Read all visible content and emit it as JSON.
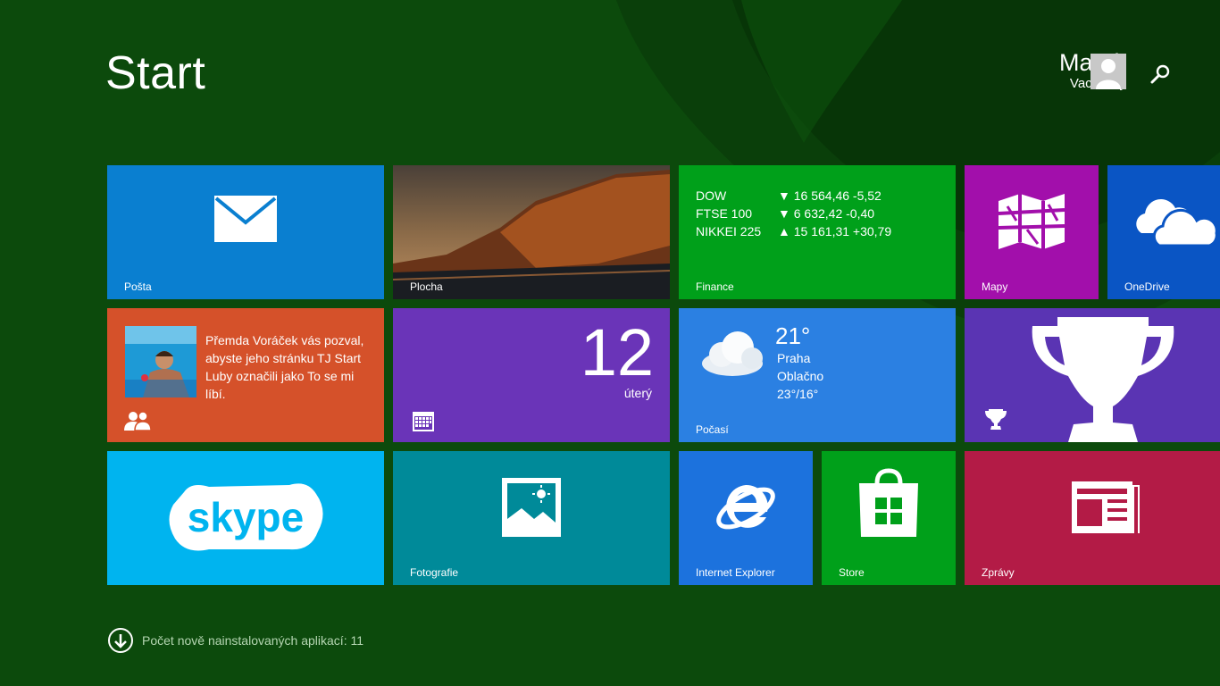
{
  "start": {
    "title": "Start"
  },
  "user": {
    "first_name": "Marek",
    "last_name": "Vacovský"
  },
  "tiles": {
    "mail": {
      "label": "Pošta"
    },
    "desktop": {
      "label": "Plocha"
    },
    "finance": {
      "label": "Finance",
      "rows": [
        {
          "name": "DOW",
          "value": "▼ 16 564,46 -5,52"
        },
        {
          "name": "FTSE 100",
          "value": "▼ 6 632,42 -0,40"
        },
        {
          "name": "NIKKEI 225",
          "value": "▲ 15 161,31 +30,79"
        }
      ]
    },
    "maps": {
      "label": "Mapy"
    },
    "onedrive": {
      "label": "OneDrive"
    },
    "people": {
      "text": "Přemda Voráček vás pozval, abyste jeho stránku TJ Start Luby označili jako To se mi líbí."
    },
    "calendar": {
      "day": "12",
      "weekday": "úterý"
    },
    "weather": {
      "label": "Počasí",
      "temp": "21°",
      "city": "Praha",
      "condition": "Oblačno",
      "range": "23°/16°"
    },
    "skype": {
      "text": "skype"
    },
    "photos": {
      "label": "Fotografie"
    },
    "ie": {
      "label": "Internet Explorer"
    },
    "store": {
      "label": "Store"
    },
    "news": {
      "label": "Zprávy"
    }
  },
  "footer": {
    "installed_text": "Počet nově nainstalovaných aplikací: 11"
  },
  "colors": {
    "background": "#0c4a0c",
    "mail": "#0a7fd0",
    "finance": "#00a01a",
    "maps": "#a20fab",
    "onedrive": "#0a55c4",
    "people": "#d5512a",
    "calendar": "#6a34b8",
    "weather": "#2b80e2",
    "games": "#5a34b3",
    "skype": "#00b4ef",
    "photos": "#008a99",
    "ie": "#1c72dd",
    "store": "#00a01a",
    "news": "#b31b46"
  },
  "icons": [
    "mail-icon",
    "maps-icon",
    "onedrive-cloud-icon",
    "people-icon",
    "calendar-icon",
    "cloud-weather-icon",
    "trophy-icon",
    "skype-logo",
    "photos-icon",
    "ie-logo",
    "store-bag-icon",
    "news-icon",
    "search-icon",
    "download-arrow-icon",
    "user-avatar-icon"
  ]
}
